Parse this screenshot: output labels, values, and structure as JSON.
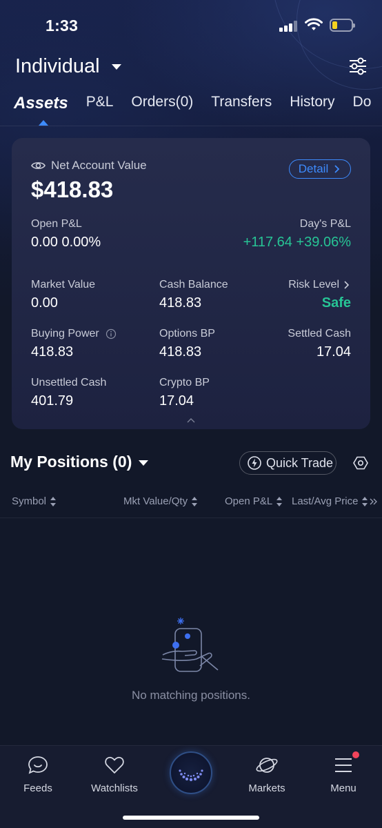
{
  "status_bar": {
    "time": "1:33"
  },
  "header": {
    "account_name": "Individual"
  },
  "tabs": [
    {
      "label": "Assets",
      "active": true
    },
    {
      "label": "P&L"
    },
    {
      "label": "Orders(0)"
    },
    {
      "label": "Transfers"
    },
    {
      "label": "History"
    },
    {
      "label": "Do"
    }
  ],
  "account_card": {
    "net_label": "Net Account Value",
    "net_value": "$418.83",
    "detail_label": "Detail",
    "open_pl_label": "Open P&L",
    "open_pl_value": "0.00 0.00%",
    "day_pl_label": "Day's P&L",
    "day_pl_value": "+117.64 +39.06%",
    "market_value_label": "Market Value",
    "market_value": "0.00",
    "cash_balance_label": "Cash Balance",
    "cash_balance": "418.83",
    "risk_level_label": "Risk Level",
    "risk_level": "Safe",
    "buying_power_label": "Buying Power",
    "buying_power": "418.83",
    "options_bp_label": "Options BP",
    "options_bp": "418.83",
    "settled_cash_label": "Settled Cash",
    "settled_cash": "17.04",
    "unsettled_cash_label": "Unsettled Cash",
    "unsettled_cash": "401.79",
    "crypto_bp_label": "Crypto BP",
    "crypto_bp": "17.04"
  },
  "positions": {
    "title": "My Positions (0)",
    "quick_trade": "Quick Trade",
    "columns": [
      "Symbol",
      "Mkt Value/Qty",
      "Open P&L",
      "Last/Avg Price"
    ],
    "empty_text": "No matching positions."
  },
  "bottom_nav": [
    {
      "label": "Feeds",
      "icon": "chat-bubble-icon"
    },
    {
      "label": "Watchlists",
      "icon": "heart-icon"
    },
    {
      "label": "Markets",
      "icon": "planet-icon"
    },
    {
      "label": "Menu",
      "icon": "hamburger-icon"
    }
  ],
  "colors": {
    "accent": "#3d8bfd",
    "positive": "#27c495",
    "badge": "#f2445b"
  }
}
